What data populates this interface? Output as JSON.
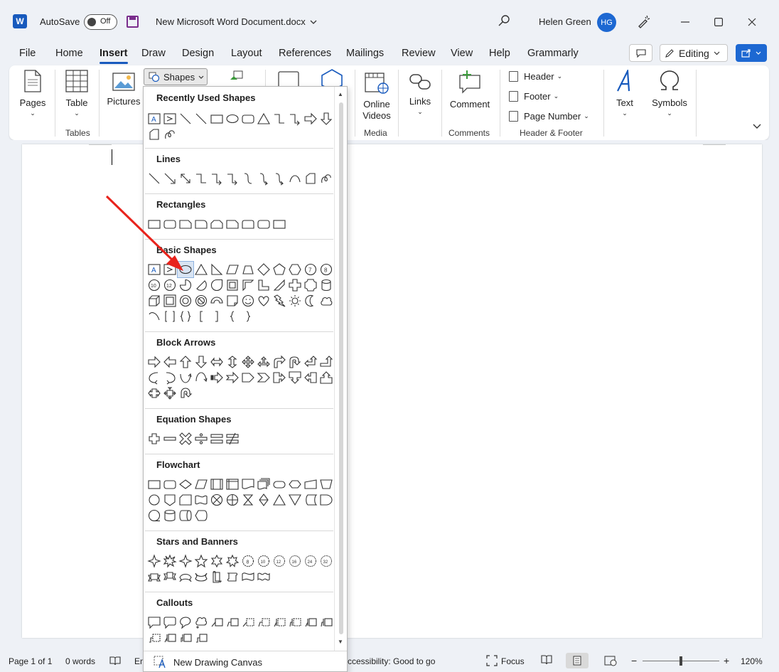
{
  "titlebar": {
    "app_logo": "W",
    "autosave_label": "AutoSave",
    "autosave_state": "Off",
    "doc_title": "New Microsoft Word Document.docx",
    "user_name": "Helen Green",
    "user_initials": "HG"
  },
  "tabs": [
    "File",
    "Home",
    "Insert",
    "Draw",
    "Design",
    "Layout",
    "References",
    "Mailings",
    "Review",
    "View",
    "Help",
    "Grammarly"
  ],
  "active_tab": "Insert",
  "editing_label": "Editing",
  "ribbon": {
    "pages": "Pages",
    "table": "Table",
    "tables_group": "Tables",
    "pictures": "Pictures",
    "shapes": "Shapes",
    "online_videos_1": "Online",
    "online_videos_2": "Videos",
    "media_group": "Media",
    "links": "Links",
    "comment": "Comment",
    "comments_group": "Comments",
    "header": "Header",
    "footer": "Footer",
    "page_number": "Page Number",
    "header_footer_group": "Header & Footer",
    "text": "Text",
    "symbols": "Symbols"
  },
  "shapes_panel": {
    "categories": [
      {
        "title": "Recently Used Shapes"
      },
      {
        "title": "Lines"
      },
      {
        "title": "Rectangles"
      },
      {
        "title": "Basic Shapes"
      },
      {
        "title": "Block Arrows"
      },
      {
        "title": "Equation Shapes"
      },
      {
        "title": "Flowchart"
      },
      {
        "title": "Stars and Banners"
      },
      {
        "title": "Callouts"
      }
    ],
    "new_drawing_canvas": "New Drawing Canvas"
  },
  "statusbar": {
    "page": "Page 1 of 1",
    "words": "0 words",
    "lang_fragment": "En",
    "accessibility": "ccessibility: Good to go",
    "focus": "Focus",
    "zoom": "120%"
  },
  "colors": {
    "accent": "#185abd",
    "annotation_arrow": "#e8231c",
    "selection": "#d8e4f3"
  }
}
